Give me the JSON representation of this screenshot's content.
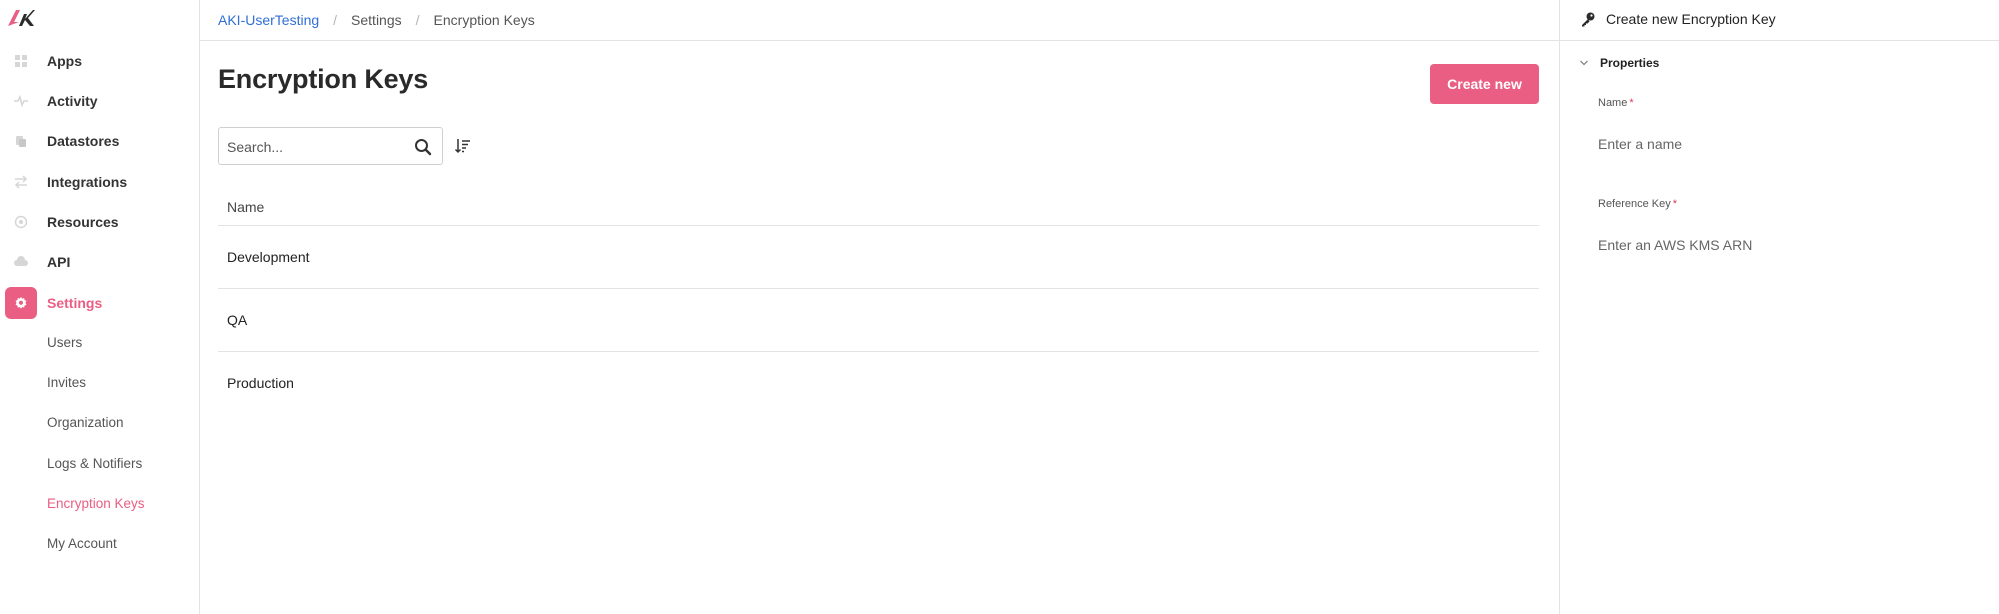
{
  "colors": {
    "accent": "#ea5e84",
    "link": "#2f6fd6",
    "border": "#e3e3e3"
  },
  "sidebar": {
    "logo": "AK",
    "items": [
      {
        "label": "Apps",
        "icon": "grid-icon"
      },
      {
        "label": "Activity",
        "icon": "pulse-icon"
      },
      {
        "label": "Datastores",
        "icon": "database-icon"
      },
      {
        "label": "Integrations",
        "icon": "arrows-icon"
      },
      {
        "label": "Resources",
        "icon": "globe-icon"
      },
      {
        "label": "API",
        "icon": "cloud-icon"
      },
      {
        "label": "Settings",
        "icon": "gear-icon",
        "active": true
      }
    ],
    "subitems": [
      {
        "label": "Users"
      },
      {
        "label": "Invites"
      },
      {
        "label": "Organization"
      },
      {
        "label": "Logs & Notifiers"
      },
      {
        "label": "Encryption Keys",
        "active": true
      },
      {
        "label": "My Account"
      }
    ]
  },
  "breadcrumb": [
    "AKI-UserTesting",
    "Settings",
    "Encryption Keys"
  ],
  "main": {
    "title": "Encryption Keys",
    "create_label": "Create new",
    "search_placeholder": "Search...",
    "table": {
      "header": "Name",
      "rows": [
        "Development",
        "QA",
        "Production"
      ]
    }
  },
  "panel": {
    "title": "Create new Encryption Key",
    "section": "Properties",
    "fields": [
      {
        "label": "Name",
        "required": "*",
        "placeholder": "Enter a name"
      },
      {
        "label": "Reference Key",
        "required": "*",
        "placeholder": "Enter an AWS KMS ARN"
      }
    ]
  }
}
